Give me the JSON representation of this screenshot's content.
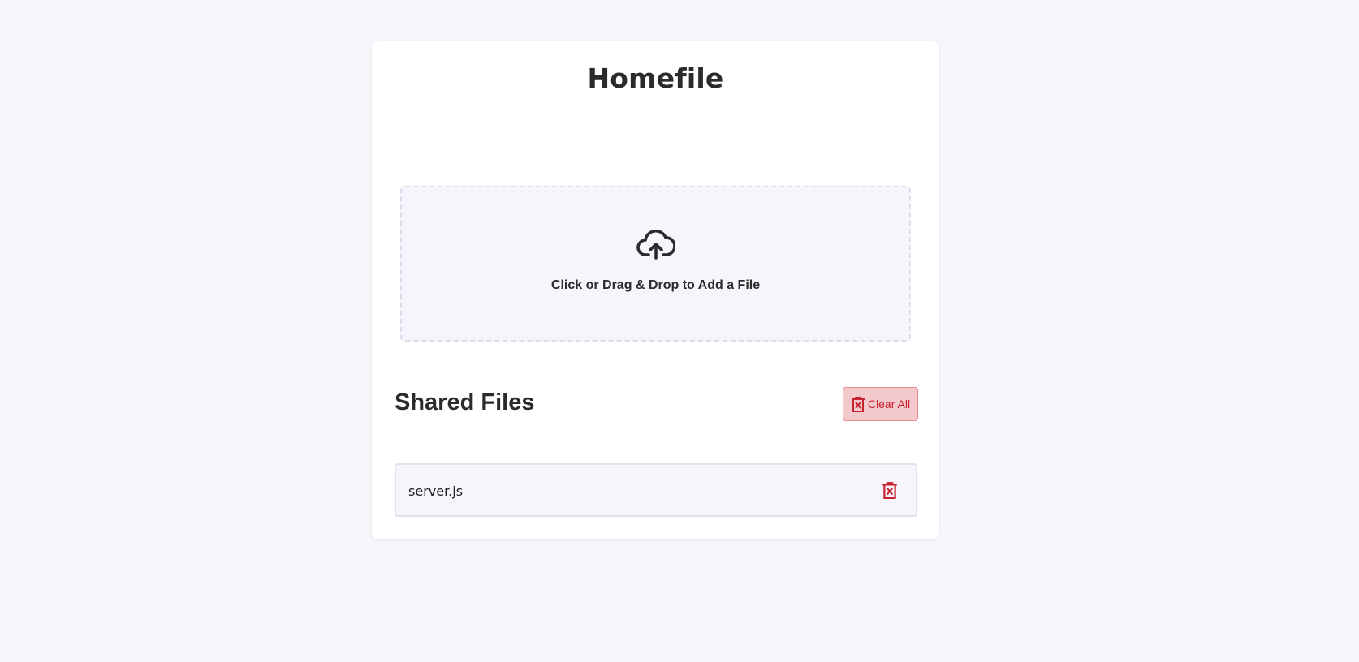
{
  "app": {
    "title": "Homefile"
  },
  "upload": {
    "icon": "cloud-upload-icon",
    "label": "Click or Drag & Drop to Add a File"
  },
  "shared_files": {
    "heading": "Shared Files",
    "clear_all_label": "Clear All",
    "clear_all_icon": "trash-x-icon",
    "items": [
      {
        "name": "server.js",
        "delete_icon": "trash-x-icon"
      }
    ]
  },
  "colors": {
    "background": "#f5f5fa",
    "card": "#ffffff",
    "danger": "#c62230",
    "danger_bg": "#f3c9cb",
    "text": "#2b2b2b"
  }
}
